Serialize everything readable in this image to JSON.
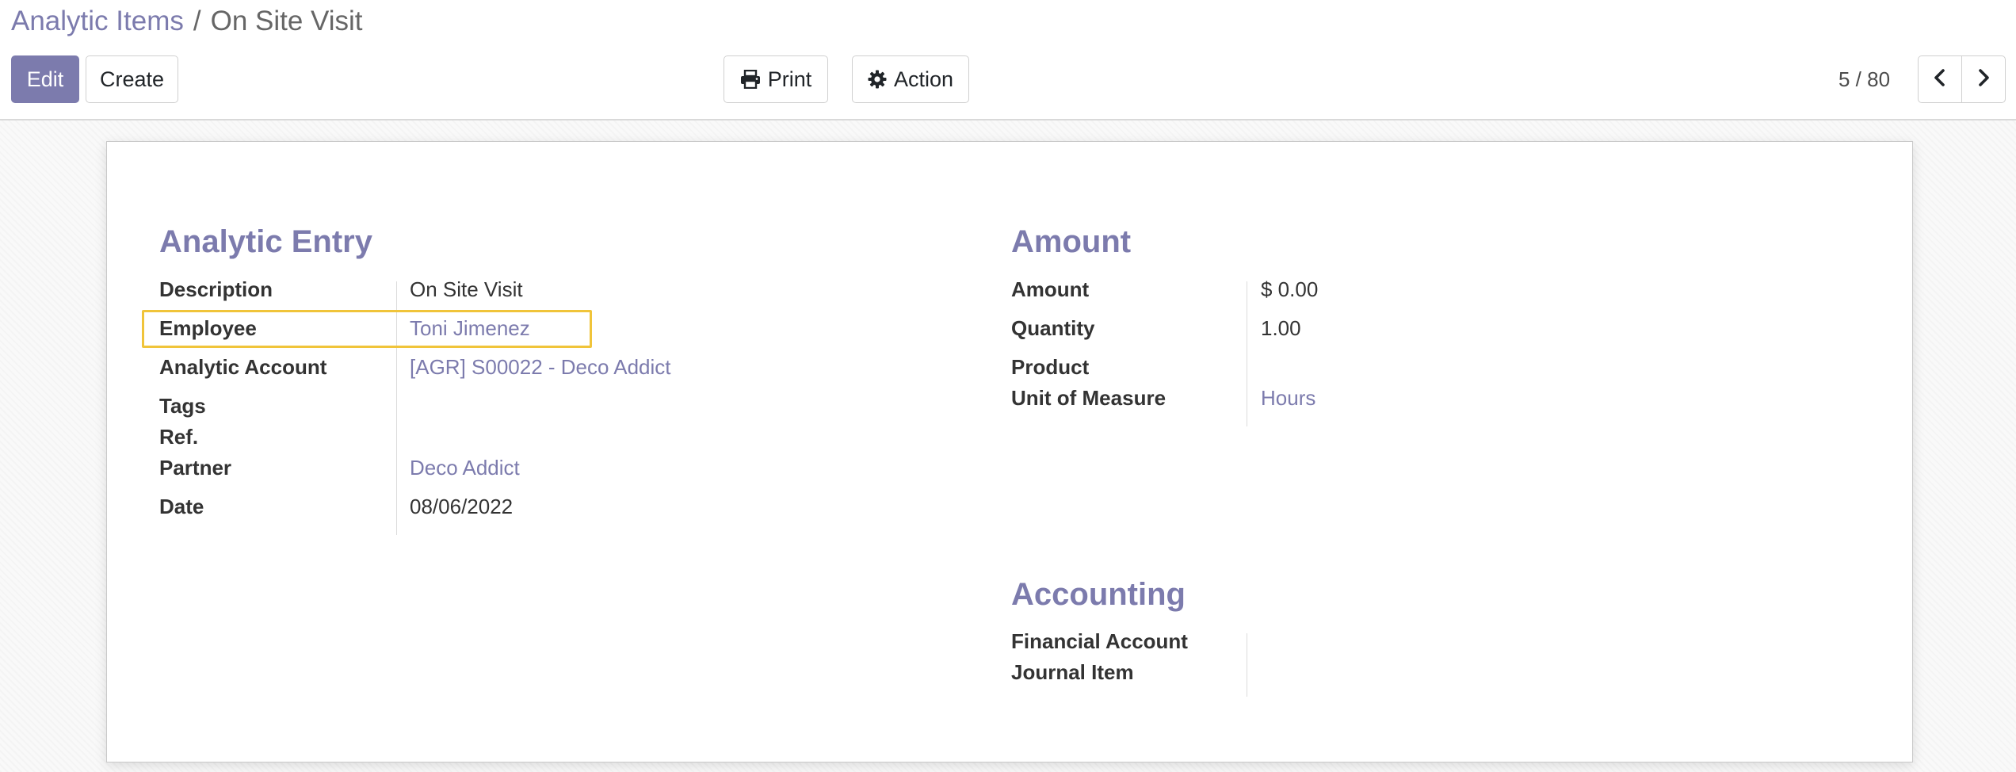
{
  "breadcrumb": {
    "parent": "Analytic Items",
    "separator": "/",
    "current": "On Site Visit"
  },
  "toolbar": {
    "edit_label": "Edit",
    "create_label": "Create",
    "print_label": "Print",
    "action_label": "Action",
    "print_icon": "printer-icon",
    "action_icon": "gear-icon"
  },
  "pager": {
    "value": "5 / 80",
    "prev_icon": "chevron-left-icon",
    "next_icon": "chevron-right-icon"
  },
  "colors": {
    "accent": "#7c7bad",
    "highlight": "#f0c43a"
  },
  "analytic_entry": {
    "title": "Analytic Entry",
    "description_label": "Description",
    "description_value": "On Site Visit",
    "employee_label": "Employee",
    "employee_value": "Toni Jimenez",
    "analytic_account_label": "Analytic Account",
    "analytic_account_value": "[AGR] S00022 - Deco Addict",
    "tags_label": "Tags",
    "ref_label": "Ref.",
    "partner_label": "Partner",
    "partner_value": "Deco Addict",
    "date_label": "Date",
    "date_value": "08/06/2022"
  },
  "amount": {
    "title": "Amount",
    "amount_label": "Amount",
    "amount_value": "$ 0.00",
    "quantity_label": "Quantity",
    "quantity_value": "1.00",
    "product_label": "Product",
    "uom_label": "Unit of Measure",
    "uom_value": "Hours"
  },
  "accounting": {
    "title": "Accounting",
    "financial_account_label": "Financial Account",
    "journal_item_label": "Journal Item"
  }
}
